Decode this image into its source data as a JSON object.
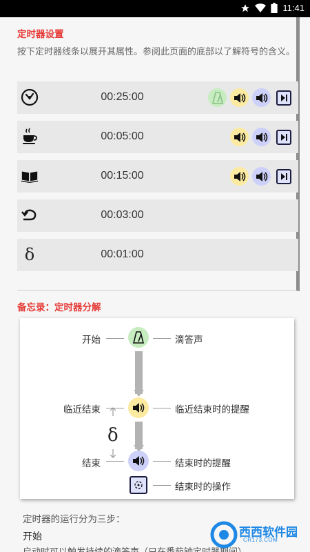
{
  "status_bar": {
    "time": "11:41"
  },
  "settings": {
    "title": "定时器设置",
    "description": "按下定时器线条以展开其属性。参阅此页面的底部以了解符号的含义。"
  },
  "timers": [
    {
      "icon": "alarm-clock-icon",
      "time": "00:25:00",
      "badges": [
        "metronome",
        "speaker-yellow",
        "speaker-blue",
        "skip-action"
      ]
    },
    {
      "icon": "coffee-cup-icon",
      "time": "00:05:00",
      "badges": [
        "speaker-yellow",
        "speaker-blue",
        "skip-action"
      ]
    },
    {
      "icon": "book-icon",
      "time": "00:15:00",
      "badges": [
        "speaker-yellow",
        "speaker-blue",
        "skip-action"
      ]
    },
    {
      "icon": "repeat-arrow-icon",
      "time": "00:03:00",
      "badges": []
    },
    {
      "icon": "delta-icon",
      "time": "00:01:00",
      "badges": []
    }
  ],
  "memo": {
    "title": "备忘录：定时器分解",
    "start_label": "开始",
    "tick_label": "滴答声",
    "near_end_label": "临近结束",
    "near_end_reminder_label": "临近结束时的提醒",
    "delta_symbol": "δ",
    "end_label": "结束",
    "end_reminder_label": "结束时的提醒",
    "end_action_label": "结束时的操作"
  },
  "footer": {
    "intro": "定时器的运行分为三步：",
    "step_start": "开始",
    "step_start_desc": "启动时可以触发持续的滴答声（只在番茄钟定时器期间）"
  },
  "watermark": {
    "brand": "西西软件园",
    "domain": "CR173.COM"
  },
  "colors": {
    "accent_red": "#e53935",
    "green_badge": "#c6ecc0",
    "yellow_badge": "#fbeaa0",
    "blue_badge": "#cdd0f8"
  }
}
